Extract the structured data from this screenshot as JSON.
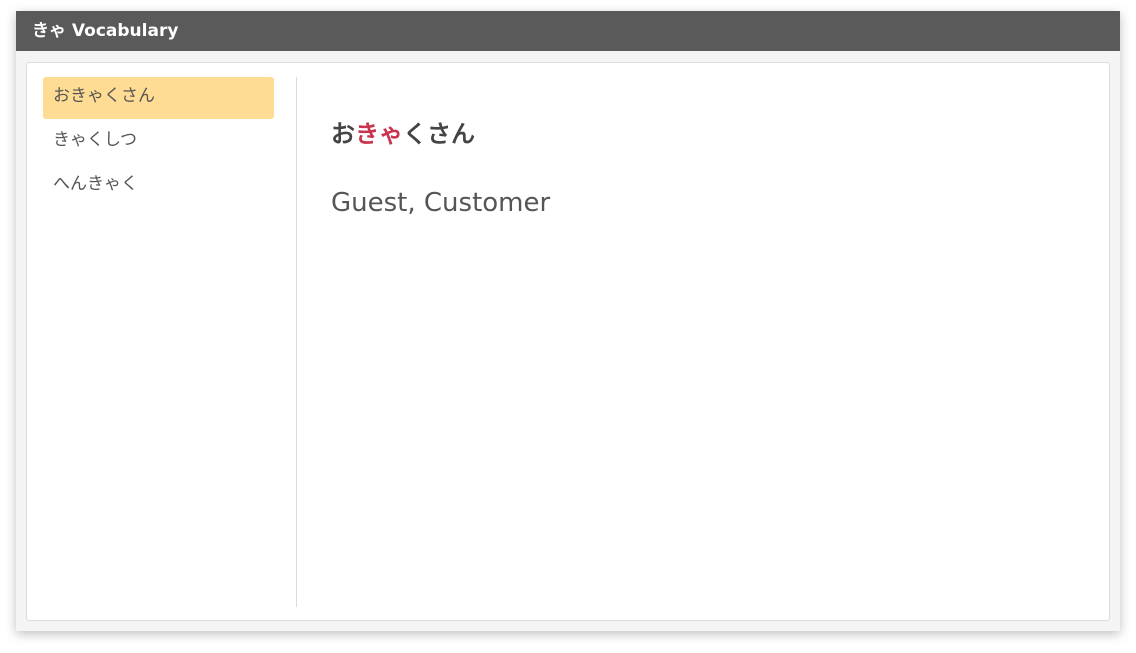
{
  "app": {
    "title": "きゃ Vocabulary"
  },
  "sidebar": {
    "items": [
      {
        "label": "おきゃくさん",
        "selected": true
      },
      {
        "label": "きゃくしつ",
        "selected": false
      },
      {
        "label": "へんきゃく",
        "selected": false
      }
    ]
  },
  "detail": {
    "word": {
      "prefix": "お",
      "highlight": "きゃ",
      "suffix": "くさん"
    },
    "meaning": "Guest, Customer"
  },
  "colors": {
    "titlebar": "#5a5a5a",
    "selected_item": "#ffdc94",
    "highlight_text": "#c9334d"
  }
}
